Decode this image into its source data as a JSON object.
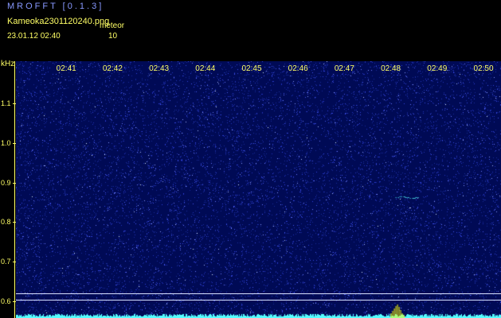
{
  "header": {
    "app_title": "MROFFT [0.1.3]",
    "file_name": "Kameoka2301120240.png",
    "meteor_label": "meteor",
    "timestamp": "23.01.12 02:40",
    "meteor_count": "10"
  },
  "colors": {
    "background": "#000000",
    "plot_bg": "#000a55",
    "text": "#ffff66",
    "title": "#8899ff",
    "noise": "#6677ff",
    "signal": "#55ffff",
    "echo": "#ffff00"
  },
  "chart_data": {
    "type": "heatmap",
    "title": "",
    "unit_label": "kHz",
    "x_ticks": [
      "02:41",
      "02:42",
      "02:43",
      "02:44",
      "02:45",
      "02:46",
      "02:47",
      "02:48",
      "02:49",
      "02:50"
    ],
    "x_range": [
      "02:40",
      "02:50"
    ],
    "y_ticks": [
      "1.1",
      "1.0",
      "0.9",
      "0.8",
      "0.7",
      "0.6"
    ],
    "y_range": [
      0.58,
      1.2
    ],
    "reference_lines_khz": [
      0.62,
      0.605
    ],
    "meteor_echo": {
      "time": "02:48",
      "freq_khz": 0.863
    }
  }
}
